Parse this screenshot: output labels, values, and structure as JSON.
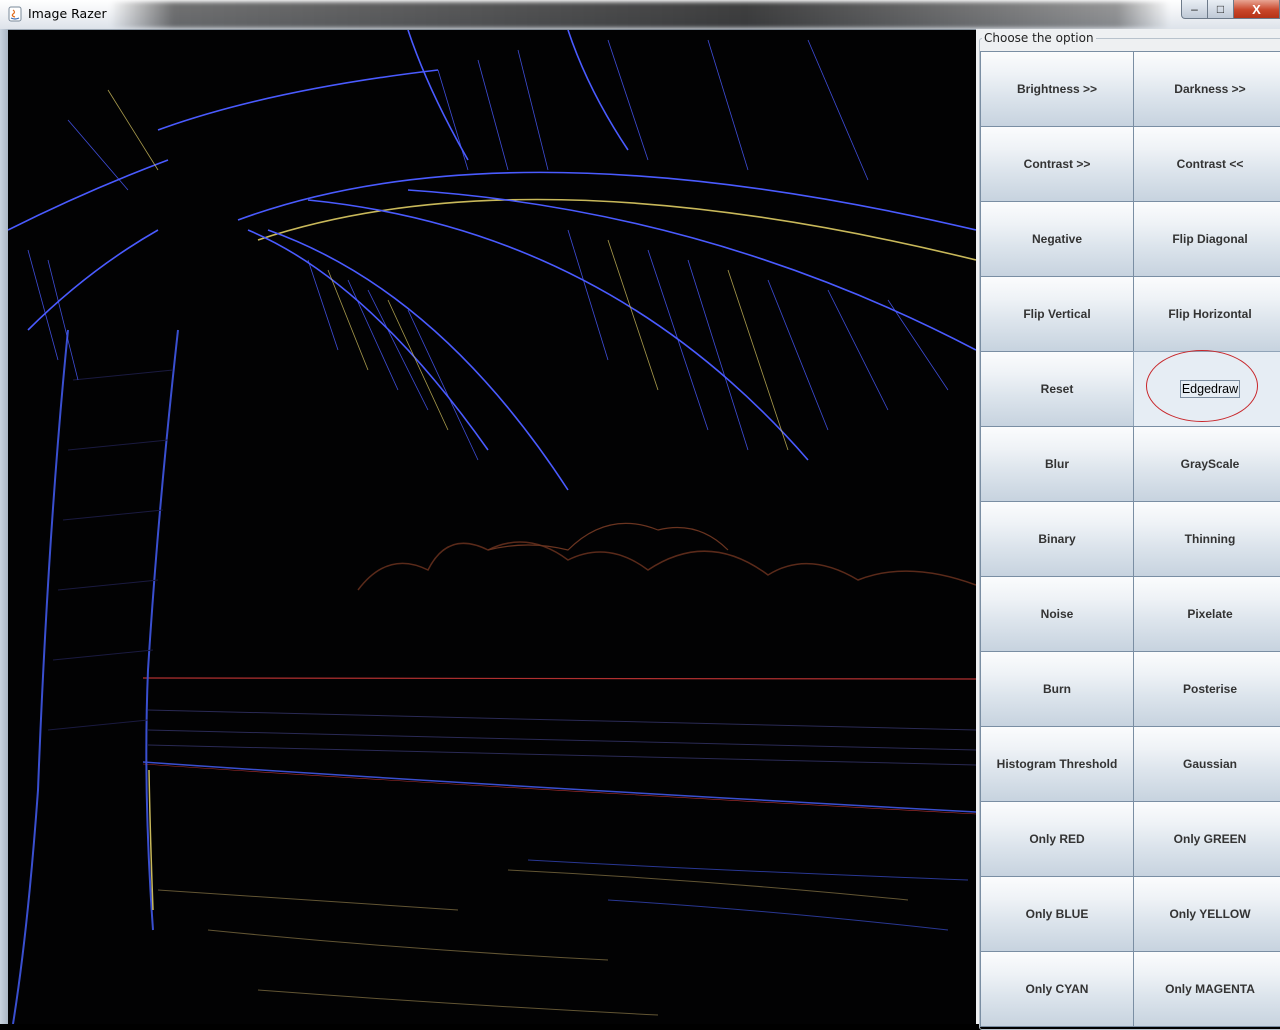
{
  "window": {
    "title": "Image Razer",
    "controls": {
      "minimize": "–",
      "maximize": "□",
      "close": "X"
    }
  },
  "panel": {
    "legend": "Choose the option",
    "options": [
      "Brightness >>",
      "Darkness >>",
      "Contrast >>",
      "Contrast <<",
      "Negative",
      "Flip Diagonal",
      "Flip Vertical",
      "Flip Horizontal",
      "Reset",
      "Edgedraw",
      "Blur",
      "GrayScale",
      "Binary",
      "Thinning",
      "Noise",
      "Pixelate",
      "Burn",
      "Posterise",
      "Histogram Threshold",
      "Gaussian",
      "Only RED",
      "Only GREEN",
      "Only BLUE",
      "Only YELLOW",
      "Only CYAN",
      "Only MAGENTA"
    ],
    "selected": "Edgedraw",
    "highlight_color": "#c8262a"
  },
  "image": {
    "description_colors": {
      "edge_blue": "#4a5bff",
      "edge_yellow": "#c8b85a",
      "edge_red": "#c03a3a"
    }
  }
}
